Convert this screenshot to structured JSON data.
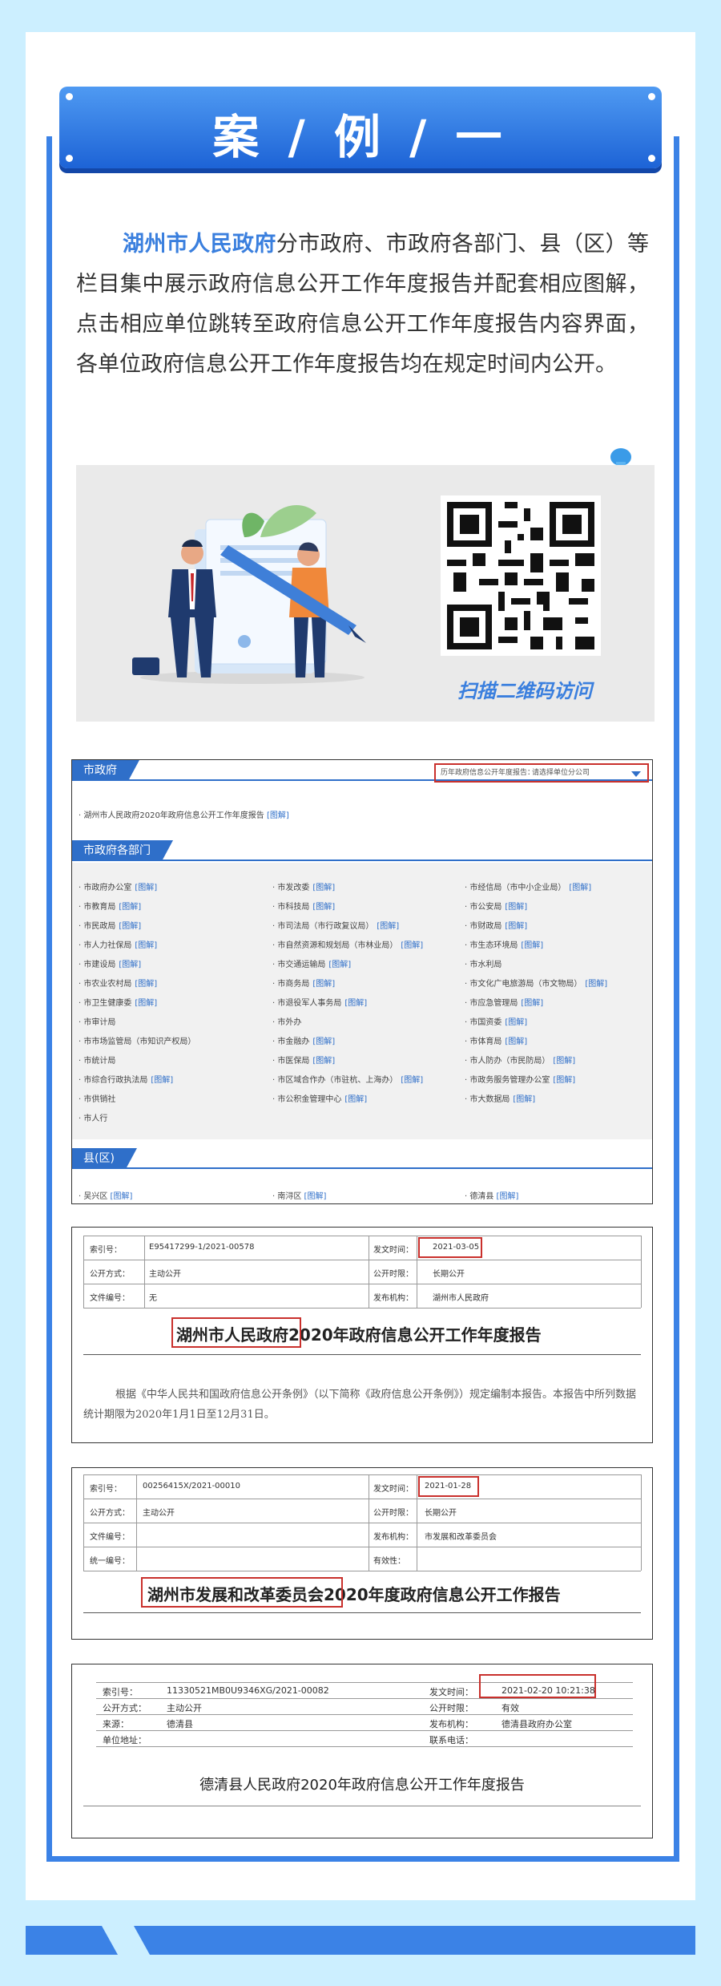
{
  "banner": {
    "title": "案 / 例 / 一"
  },
  "intro": {
    "highlight": "湖州市人民政府",
    "text": "分市政府、市政府各部门、县（区）等栏目集中展示政府信息公开工作年度报告并配套相应图解，点击相应单位跳转至政府信息公开工作年度报告内容界面，各单位政府信息公开工作年度报告均在规定时间内公开。"
  },
  "hero": {
    "scan_text": "扫描二维码访问"
  },
  "portal": {
    "tab_city": "市政府",
    "select_label": "历年政府信息公开年度报告：",
    "select_value": "请选择单位分公司",
    "city_report": "· 湖州市人民政府2020年政府信息公开工作年度报告",
    "tuijie": "[图解]",
    "tab_departments": "市政府各部门",
    "departments": [
      [
        "· 市政府办公室",
        "· 市发改委",
        "· 市经信局（市中小企业局）"
      ],
      [
        "· 市教育局",
        "· 市科技局",
        "· 市公安局"
      ],
      [
        "· 市民政局",
        "· 市司法局（市行政复议局）",
        "· 市财政局"
      ],
      [
        "· 市人力社保局",
        "· 市自然资源和规划局（市林业局）",
        "· 市生态环境局"
      ],
      [
        "· 市建设局",
        "· 市交通运输局",
        "· 市水利局"
      ],
      [
        "· 市农业农村局",
        "· 市商务局",
        "· 市文化广电旅游局（市文物局）"
      ],
      [
        "· 市卫生健康委",
        "· 市退役军人事务局",
        "· 市应急管理局"
      ],
      [
        "· 市审计局",
        "· 市外办",
        "· 市国资委"
      ],
      [
        "· 市市场监管局（市知识产权局）",
        "· 市金融办",
        "· 市体育局"
      ],
      [
        "· 市统计局",
        "· 市医保局",
        "· 市人防办（市民防局）"
      ],
      [
        "· 市综合行政执法局",
        "· 市区域合作办（市驻杭、上海办）",
        "· 市政务服务管理办公室"
      ],
      [
        "· 市供销社",
        "· 市公积金管理中心",
        "· 市大数据局"
      ],
      [
        "· 市人行",
        "",
        ""
      ]
    ],
    "dept_links": [
      [
        true,
        true,
        true
      ],
      [
        true,
        true,
        true
      ],
      [
        true,
        true,
        true
      ],
      [
        true,
        true,
        true
      ],
      [
        true,
        true,
        false
      ],
      [
        true,
        true,
        true
      ],
      [
        true,
        true,
        true
      ],
      [
        false,
        false,
        true
      ],
      [
        false,
        true,
        true
      ],
      [
        false,
        true,
        true
      ],
      [
        true,
        true,
        true
      ],
      [
        false,
        true,
        true
      ],
      [
        false,
        false,
        false
      ]
    ],
    "tab_county": "县(区)",
    "counties": [
      "· 吴兴区",
      "· 南浔区",
      "· 德清县"
    ]
  },
  "doc1": {
    "index_label": "索引号：",
    "index_value": "E95417299-1/2021-00578",
    "date_label": "发文时间：",
    "date_value": "2021-03-05",
    "open_label": "公开方式：",
    "open_value": "主动公开",
    "period_label": "公开时限：",
    "period_value": "长期公开",
    "docno_label": "文件编号：",
    "docno_value": "无",
    "org_label": "发布机构：",
    "org_value": "湖州市人民政府",
    "title_a": "湖州市人民政府",
    "title_b": "2020年政府信息公开工作年度报告",
    "para": "根据《中华人民共和国政府信息公开条例》（以下简称《政府信息公开条例》）规定编制本报告。本报告中所列数据统计期限为2020年1月1日至12月31日。"
  },
  "doc2": {
    "index_label": "索引号：",
    "index_value": "00256415X/2021-00010",
    "date_label": "发文时间：",
    "date_value": "2021-01-28",
    "open_label": "公开方式：",
    "open_value": "主动公开",
    "period_label": "公开时限：",
    "period_value": "长期公开",
    "docno_label": "文件编号：",
    "docno_value": "",
    "org_label": "发布机构：",
    "org_value": "市发展和改革委员会",
    "unino_label": "统一编号：",
    "unino_value": "",
    "valid_label": "有效性：",
    "valid_value": "",
    "title_a": "湖州市发展和改革委员会",
    "title_b": "2020年度政府信息公开工作报告"
  },
  "doc3": {
    "index_label": "索引号：",
    "index_value": "11330521MB0U9346XG/2021-00082",
    "date_label": "发文时间：",
    "date_value": "2021-02-20 10:21:38",
    "open_label": "公开方式：",
    "open_value": "主动公开",
    "period_label": "公开时限：",
    "period_value": "有效",
    "source_label": "来源：",
    "source_value": "德清县",
    "org_label": "发布机构：",
    "org_value": "德清县政府办公室",
    "addr_label": "单位地址：",
    "addr_value": "",
    "phone_label": "联系电话：",
    "phone_value": "",
    "title": "德清县人民政府2020年政府信息公开工作年度报告"
  },
  "colors": {
    "accent": "#3b82e6",
    "highlight": "#3a7fde",
    "red": "#c9302c",
    "bg": "#ccefff"
  }
}
